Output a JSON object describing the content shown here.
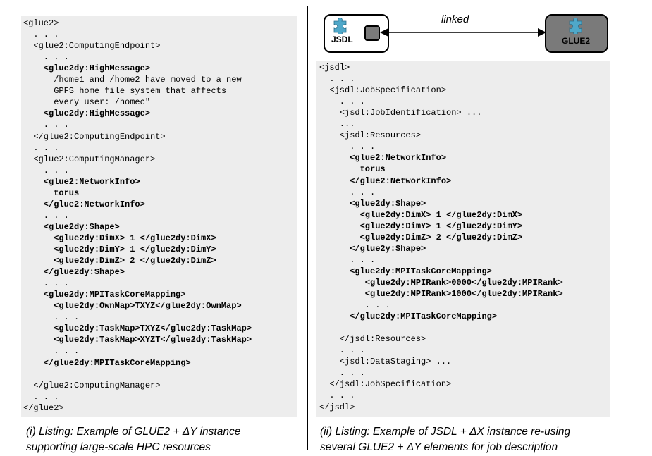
{
  "diagram": {
    "jsdl_label": "JSDL",
    "glue2_label": "GLUE2",
    "link_label": "linked",
    "jsdl_icon": "puzzle-piece-icon",
    "glue2_icon": "puzzle-piece-icon",
    "puzzle_color": "#4fa8c9",
    "glue2_fill": "#7a7a7a"
  },
  "left_listing": {
    "lines": [
      {
        "text": "<glue2>",
        "bold": false
      },
      {
        "text": "  . . .",
        "bold": false
      },
      {
        "text": "  <glue2:ComputingEndpoint>",
        "bold": false
      },
      {
        "text": "    . . .",
        "bold": false
      },
      {
        "text": "    <glue2dy:HighMessage>",
        "bold": true
      },
      {
        "text": "      /home1 and /home2 have moved to a new",
        "bold": false
      },
      {
        "text": "      GPFS home file system that affects",
        "bold": false
      },
      {
        "text": "      every user: /homec\"",
        "bold": false
      },
      {
        "text": "    <glue2dy:HighMessage>",
        "bold": true
      },
      {
        "text": "    . . .",
        "bold": false
      },
      {
        "text": "  </glue2:ComputingEndpoint>",
        "bold": false
      },
      {
        "text": "  . . .",
        "bold": false
      },
      {
        "text": "  <glue2:ComputingManager>",
        "bold": false
      },
      {
        "text": "    . . .",
        "bold": false
      },
      {
        "text": "    <glue2:NetworkInfo>",
        "bold": true
      },
      {
        "text": "      torus",
        "bold": true
      },
      {
        "text": "    </glue2:NetworkInfo>",
        "bold": true
      },
      {
        "text": "    . . .",
        "bold": false
      },
      {
        "text": "    <glue2dy:Shape>",
        "bold": true
      },
      {
        "text": "      <glue2dy:DimX> 1 </glue2dy:DimX>",
        "bold": true
      },
      {
        "text": "      <glue2dy:DimY> 1 </glue2dy:DimY>",
        "bold": true
      },
      {
        "text": "      <glue2dy:DimZ> 2 </glue2dy:DimZ>",
        "bold": true
      },
      {
        "text": "    </glue2dy:Shape>",
        "bold": true
      },
      {
        "text": "    . . .",
        "bold": false
      },
      {
        "text": "    <glue2dy:MPITaskCoreMapping>",
        "bold": true
      },
      {
        "text": "      <glue2dy:OwnMap>TXYZ</glue2dy:OwnMap>",
        "bold": true
      },
      {
        "text": "      . . .",
        "bold": false
      },
      {
        "text": "      <glue2dy:TaskMap>TXYZ</glue2dy:TaskMap>",
        "bold": true
      },
      {
        "text": "      <glue2dy:TaskMap>XYZT</glue2dy:TaskMap>",
        "bold": true
      },
      {
        "text": "      . . .",
        "bold": false
      },
      {
        "text": "    </glue2dy:MPITaskCoreMapping>",
        "bold": true
      },
      {
        "text": "",
        "bold": false
      },
      {
        "text": "  </glue2:ComputingManager>",
        "bold": false
      },
      {
        "text": "  . . .",
        "bold": false
      },
      {
        "text": "</glue2>",
        "bold": false
      }
    ]
  },
  "right_listing": {
    "lines": [
      {
        "text": "<jsdl>",
        "bold": false
      },
      {
        "text": "  . . .",
        "bold": false
      },
      {
        "text": "  <jsdl:JobSpecification>",
        "bold": false
      },
      {
        "text": "    . . .",
        "bold": false
      },
      {
        "text": "    <jsdl:JobIdentification> ...",
        "bold": false
      },
      {
        "text": "    ...",
        "bold": false
      },
      {
        "text": "    <jsdl:Resources>",
        "bold": false
      },
      {
        "text": "      . . .",
        "bold": false
      },
      {
        "text": "      <glue2:NetworkInfo>",
        "bold": true
      },
      {
        "text": "        torus",
        "bold": true
      },
      {
        "text": "      </glue2:NetworkInfo>",
        "bold": true
      },
      {
        "text": "      . . .",
        "bold": false
      },
      {
        "text": "      <glue2dy:Shape>",
        "bold": true
      },
      {
        "text": "        <glue2dy:DimX> 1 </glue2dy:DimX>",
        "bold": true
      },
      {
        "text": "        <glue2dy:DimY> 1 </glue2dy:DimY>",
        "bold": true
      },
      {
        "text": "        <glue2dy:DimZ> 2 </glue2dy:DimZ>",
        "bold": true
      },
      {
        "text": "      </glue2y:Shape>",
        "bold": true
      },
      {
        "text": "      . . .",
        "bold": false
      },
      {
        "text": "      <glue2dy:MPITaskCoreMapping>",
        "bold": true
      },
      {
        "text": "         <glue2dy:MPIRank>0000</glue2dy:MPIRank>",
        "bold": true
      },
      {
        "text": "         <glue2dy:MPIRank>1000</glue2dy:MPIRank>",
        "bold": true
      },
      {
        "text": "         . . .",
        "bold": false
      },
      {
        "text": "      </glue2dy:MPITaskCoreMapping>",
        "bold": true
      },
      {
        "text": "",
        "bold": false
      },
      {
        "text": "    </jsdl:Resources>",
        "bold": false
      },
      {
        "text": "    . . .",
        "bold": false
      },
      {
        "text": "    <jsdl:DataStaging> ...",
        "bold": false
      },
      {
        "text": "    . . .",
        "bold": false
      },
      {
        "text": "  </jsdl:JobSpecification>",
        "bold": false
      },
      {
        "text": "  . . .",
        "bold": false
      },
      {
        "text": "</jsdl>",
        "bold": false
      }
    ]
  },
  "captions": {
    "left_line1": "(i) Listing: Example of GLUE2 + ΔY instance",
    "left_line2": "supporting large-scale HPC resources",
    "right_line1": "(ii) Listing: Example of JSDL + ΔX instance re-using",
    "right_line2": "several GLUE2 + ΔY elements for job description"
  }
}
